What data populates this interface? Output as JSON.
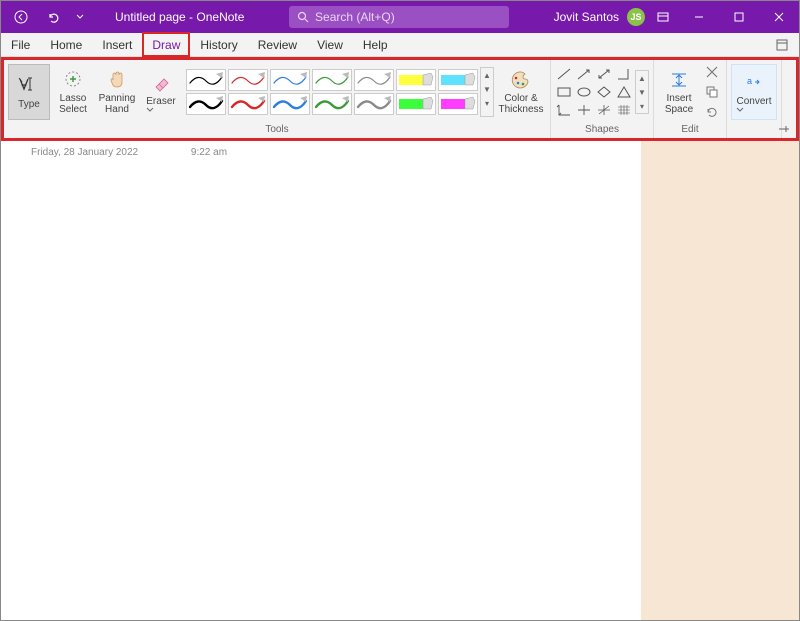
{
  "titlebar": {
    "doc_title": "Untitled page",
    "app_name": "OneNote",
    "separator": "  -  ",
    "search_placeholder": "Search (Alt+Q)",
    "user_name": "Jovit Santos",
    "user_initials": "JS"
  },
  "menu": {
    "items": [
      "File",
      "Home",
      "Insert",
      "Draw",
      "History",
      "Review",
      "View",
      "Help"
    ],
    "active_index": 3
  },
  "ribbon": {
    "tools": {
      "label": "Tools",
      "type_btn": "Type",
      "lasso_btn": "Lasso Select",
      "panning_btn": "Panning Hand",
      "eraser_btn": "Eraser",
      "color_thickness_btn": "Color & Thickness",
      "pens_row1": [
        "#000000",
        "#d9262a",
        "#2b7de0",
        "#3a9a3a",
        "#8a8a8a",
        "#ffff3e",
        "#5ee2ff"
      ],
      "pens_row2": [
        "#000000",
        "#d9262a",
        "#2b7de0",
        "#3a9a3a",
        "#8a8a8a",
        "#3cff3c",
        "#ff3cff"
      ]
    },
    "shapes": {
      "label": "Shapes"
    },
    "edit": {
      "label": "Edit",
      "insert_space_btn": "Insert Space"
    },
    "convert": {
      "label": "Convert"
    }
  },
  "page": {
    "date": "Friday, 28 January 2022",
    "time": "9:22 am"
  }
}
